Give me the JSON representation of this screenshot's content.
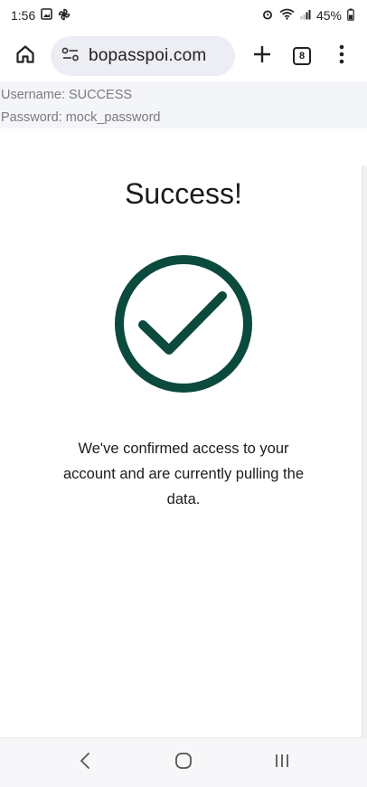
{
  "status_bar": {
    "time": "1:56",
    "battery": "45%"
  },
  "browser": {
    "url": "bopasspoi.com",
    "tab_count": "8"
  },
  "credentials": {
    "username_line": "Username: SUCCESS",
    "password_line": "Password: mock_password"
  },
  "main": {
    "title": "Success!",
    "message": "We've confirmed access to your account and are currently pulling the data.",
    "check_color": "#0b4a3c"
  },
  "icons": {
    "home": "home-icon",
    "site_settings": "site-settings-icon",
    "new_tab": "plus-icon",
    "tabs": "tab-switcher-icon",
    "menu": "more-vert-icon",
    "back": "back-icon",
    "home_nav": "home-nav-icon",
    "recents": "recents-icon"
  }
}
